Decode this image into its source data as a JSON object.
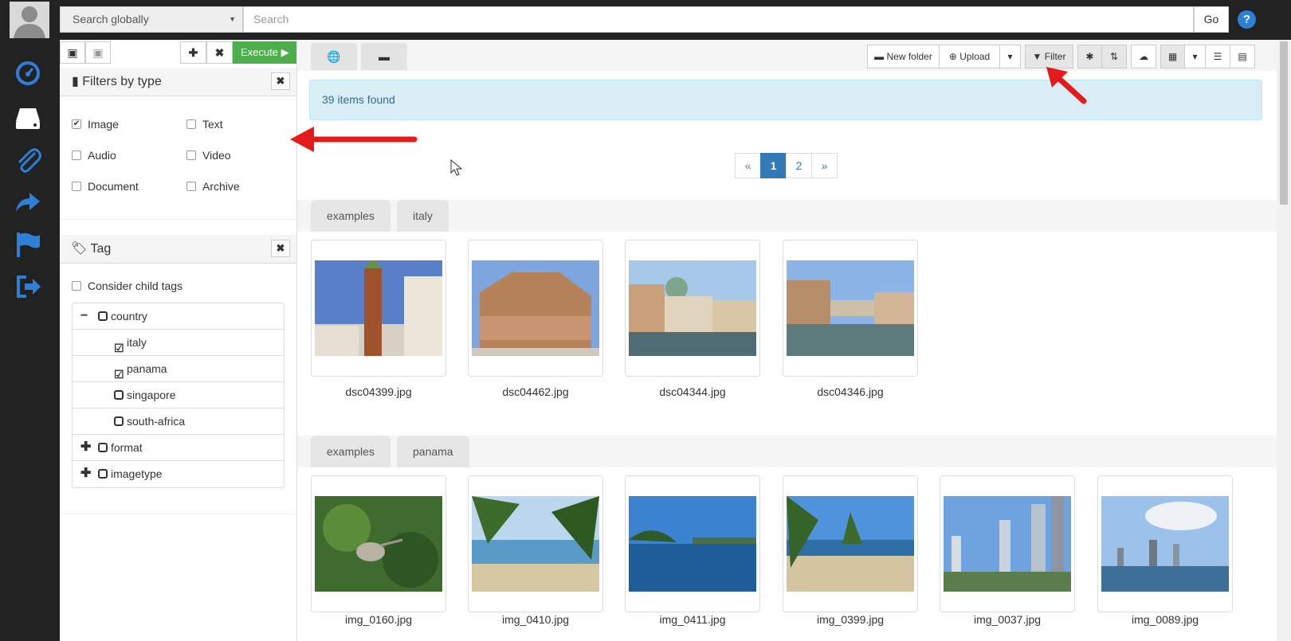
{
  "topbar": {
    "global_search_label": "Search globally",
    "search_placeholder": "Search",
    "go_label": "Go",
    "help_label": "?"
  },
  "nav": [
    "dashboard-icon",
    "drive-icon",
    "attachment-icon",
    "share-icon",
    "flag-icon",
    "logout-icon"
  ],
  "panel": {
    "execute_label": "Execute",
    "filters_title": "Filters by type",
    "types": [
      {
        "label": "Image",
        "checked": true
      },
      {
        "label": "Text",
        "checked": false
      },
      {
        "label": "Audio",
        "checked": false
      },
      {
        "label": "Video",
        "checked": false
      },
      {
        "label": "Document",
        "checked": false
      },
      {
        "label": "Archive",
        "checked": false
      }
    ],
    "tag_title": "Tag",
    "consider_child_tags": "Consider child tags",
    "tree": {
      "country": "country",
      "italy": "italy",
      "panama": "panama",
      "singapore": "singapore",
      "south_africa": "south-africa",
      "format": "format",
      "imagetype": "imagetype"
    }
  },
  "toolbar": {
    "new_folder": "New folder",
    "upload": "Upload",
    "filter": "Filter"
  },
  "results": {
    "count_text": "39 items found",
    "pager": {
      "prev": "«",
      "page1": "1",
      "page2": "2",
      "next": "»"
    }
  },
  "groups": [
    {
      "crumbs": [
        "examples",
        "italy"
      ],
      "files": [
        "dsc04399.jpg",
        "dsc04462.jpg",
        "dsc04344.jpg",
        "dsc04346.jpg"
      ]
    },
    {
      "crumbs": [
        "examples",
        "panama"
      ],
      "files": [
        "img_0160.jpg",
        "img_0410.jpg",
        "img_0411.jpg",
        "img_0399.jpg",
        "img_0037.jpg",
        "img_0089.jpg"
      ]
    }
  ],
  "colors": {
    "accent": "#337ab7",
    "execute": "#4cae4c",
    "nav_icons": "#2e7fd6",
    "annotation": "#e31b1b"
  }
}
